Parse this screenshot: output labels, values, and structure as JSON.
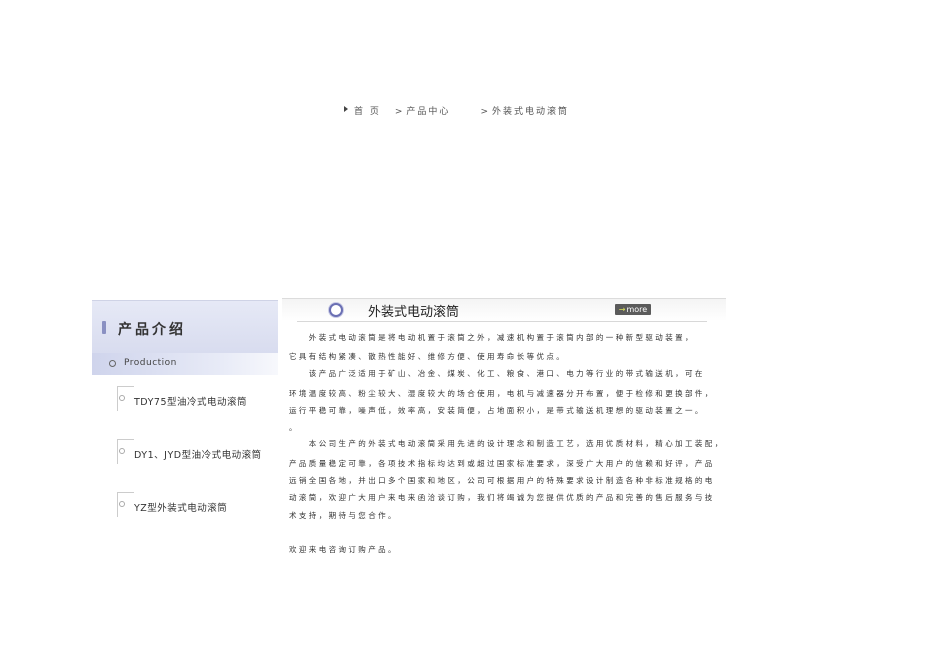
{
  "breadcrumb": {
    "home": "首 页",
    "level1": "产品中心",
    "level2": "外装式电动滚筒",
    "sep": ">"
  },
  "sidebar": {
    "title": "产品介绍",
    "subtitle": "Production",
    "items": [
      {
        "label": "TDY75型油冷式电动滚筒"
      },
      {
        "label": "DY1、JYD型油冷式电动滚筒"
      },
      {
        "label": "YZ型外装式电动滚筒"
      }
    ]
  },
  "main": {
    "title": "外装式电动滚筒",
    "more_label": "more",
    "paragraph_lines": [
      "　　外装式电动滚筒是将电动机置于滚筒之外，减速机构置于滚筒内部的一种新型驱动装置，",
      "它具有结构紧凑、散热性能好、维修方便、使用寿命长等优点。",
      "　　该产品广泛适用于矿山、冶金、煤炭、化工、粮食、港口、电力等行业的带式输送机，可在",
      "环境温度较高、粉尘较大、湿度较大的场合使用，电机与减速器分开布置，便于检修和更换部件，",
      "运行平稳可靠，噪声低，效率高，安装简便，占地面积小，是带式输送机理想的驱动装置之一。",
      "。",
      "　　本公司生产的外装式电动滚筒采用先进的设计理念和制造工艺，选用优质材料，精心加工装配，",
      "产品质量稳定可靠，各项技术指标均达到或超过国家标准要求，深受广大用户的信赖和好评，产品",
      "远销全国各地，并出口多个国家和地区，公司可根据用户的特殊要求设计制造各种非标准规格的电",
      "动滚筒，欢迎广大用户来电来函洽谈订购，我们将竭诚为您提供优质的产品和完善的售后服务与技",
      "术支持，期待与您合作。",
      "",
      "欢迎来电咨询订购产品。"
    ]
  }
}
